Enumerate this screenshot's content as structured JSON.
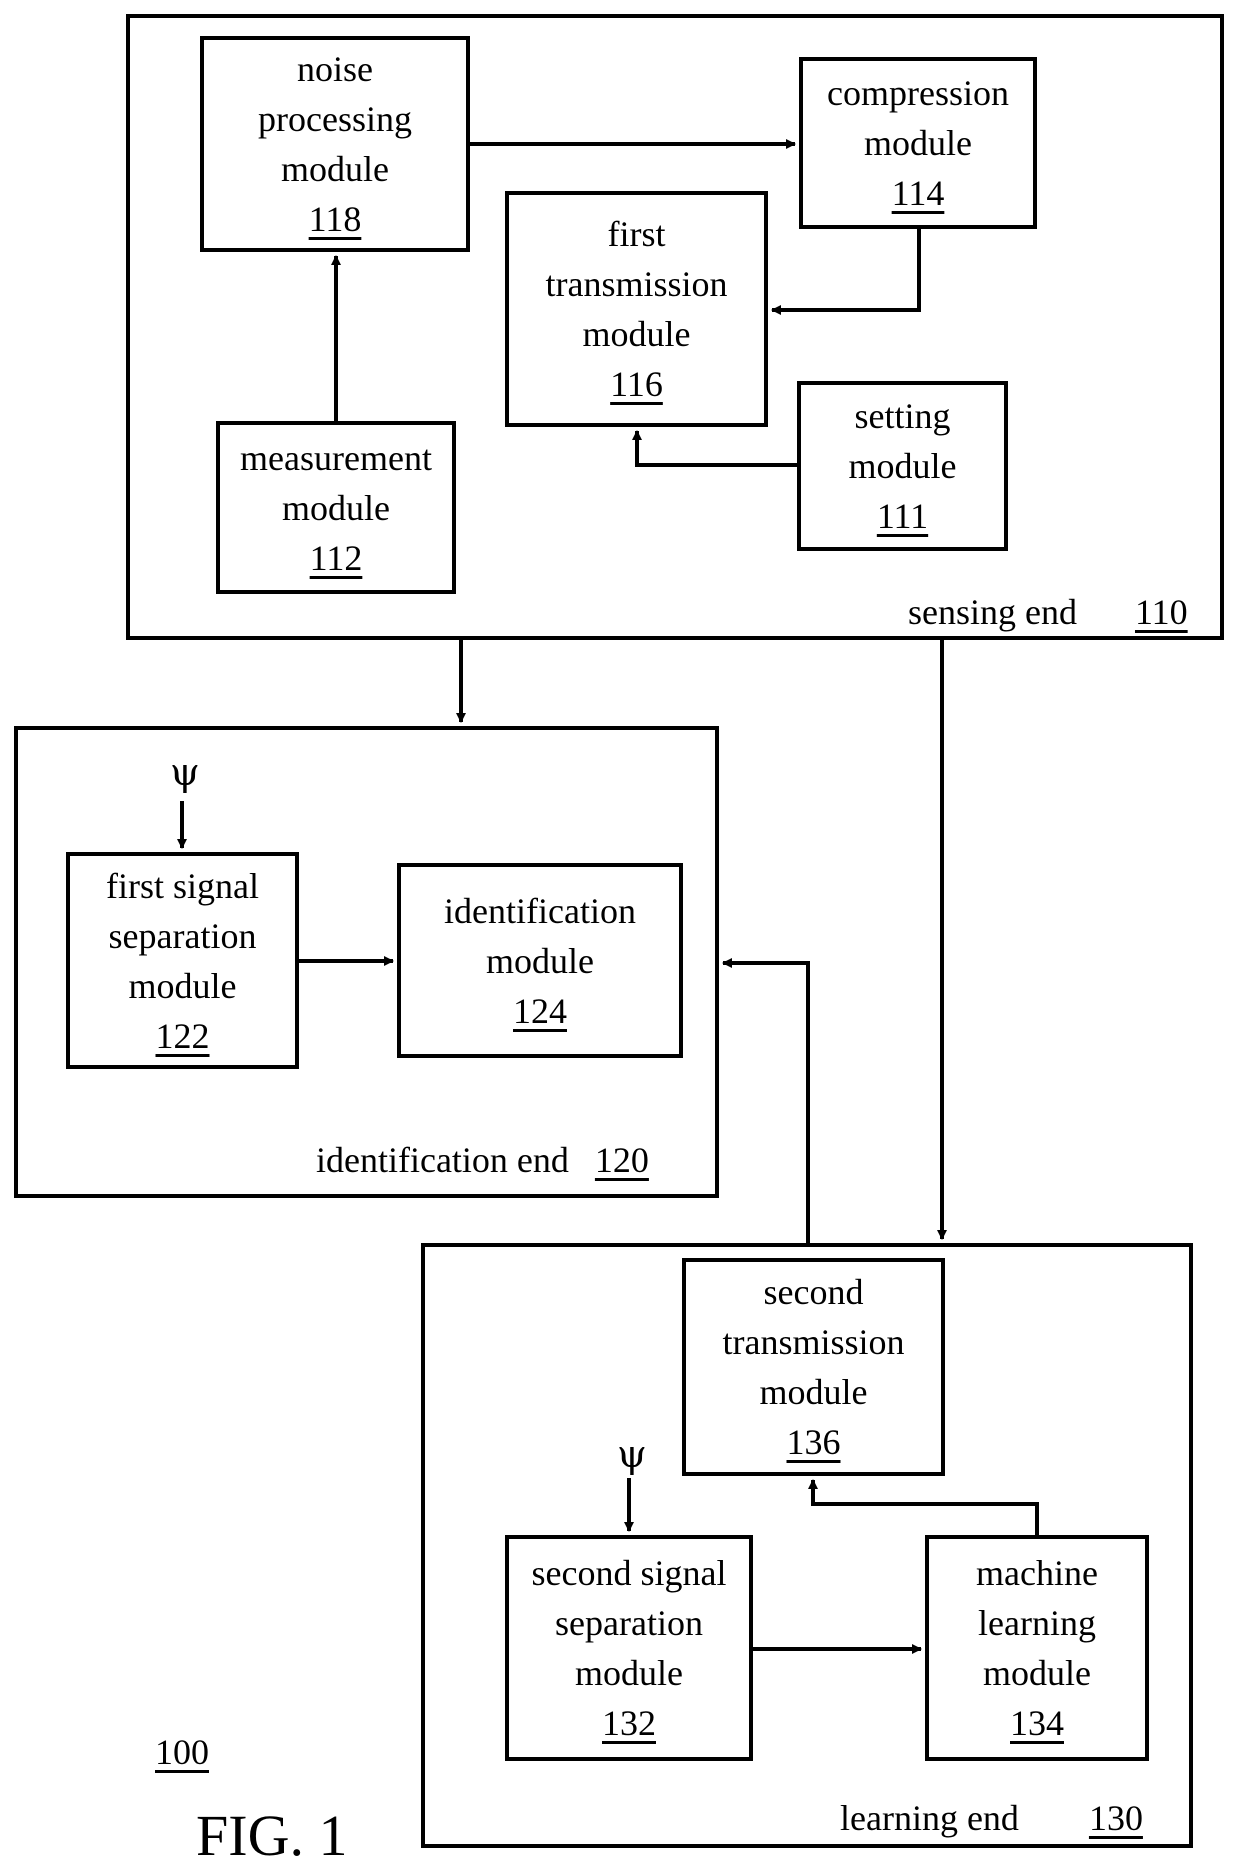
{
  "figure": {
    "title": "FIG. 1",
    "system_ref": "100"
  },
  "sensing_end": {
    "label": "sensing end",
    "ref": "110",
    "modules": {
      "noise": {
        "lines": [
          "noise",
          "processing",
          "module"
        ],
        "ref": "118"
      },
      "compression": {
        "lines": [
          "compression",
          "module"
        ],
        "ref": "114"
      },
      "first_transmission": {
        "lines": [
          "first",
          "transmission",
          "module"
        ],
        "ref": "116"
      },
      "setting": {
        "lines": [
          "setting",
          "module"
        ],
        "ref": "111"
      },
      "measurement": {
        "lines": [
          "measurement",
          "module"
        ],
        "ref": "112"
      }
    }
  },
  "identification_end": {
    "label": "identification end",
    "ref": "120",
    "psi_symbol": "ψ",
    "modules": {
      "first_signal_separation": {
        "lines": [
          "first signal",
          "separation",
          "module"
        ],
        "ref": "122"
      },
      "identification": {
        "lines": [
          "identification",
          "module"
        ],
        "ref": "124"
      }
    }
  },
  "learning_end": {
    "label": "learning end",
    "ref": "130",
    "psi_symbol": "ψ",
    "modules": {
      "second_transmission": {
        "lines": [
          "second",
          "transmission",
          "module"
        ],
        "ref": "136"
      },
      "second_signal_separation": {
        "lines": [
          "second signal",
          "separation",
          "module"
        ],
        "ref": "132"
      },
      "machine_learning": {
        "lines": [
          "machine",
          "learning",
          "module"
        ],
        "ref": "134"
      }
    }
  },
  "connections": [
    {
      "from": "measurement module 112",
      "to": "noise processing module 118"
    },
    {
      "from": "noise processing module 118",
      "to": "compression module 114"
    },
    {
      "from": "compression module 114",
      "to": "first transmission module 116"
    },
    {
      "from": "setting module 111",
      "to": "first transmission module 116"
    },
    {
      "from": "sensing end 110",
      "to": "identification end 120"
    },
    {
      "from": "sensing end 110",
      "to": "learning end 130 / second transmission module 136"
    },
    {
      "from": "ψ",
      "to": "first signal separation module 122"
    },
    {
      "from": "first signal separation module 122",
      "to": "identification module 124"
    },
    {
      "from": "learning end 130",
      "to": "identification end 120"
    },
    {
      "from": "ψ",
      "to": "second signal separation module 132"
    },
    {
      "from": "second signal separation module 132",
      "to": "machine learning module 134"
    },
    {
      "from": "machine learning module 134",
      "to": "second transmission module 136"
    }
  ]
}
